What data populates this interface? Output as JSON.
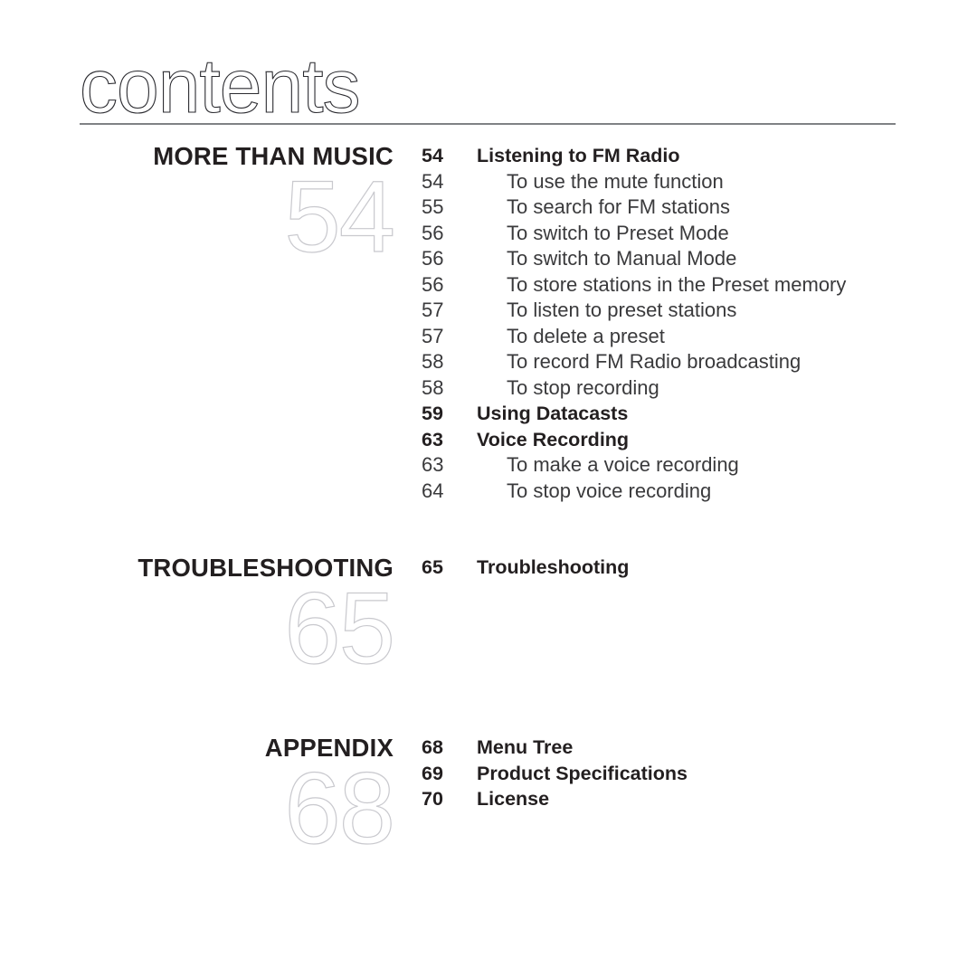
{
  "page": {
    "title": "contents"
  },
  "sections": [
    {
      "name": "more-than-music",
      "header": "MORE THAN MUSIC",
      "big_number": "54",
      "entries": [
        {
          "page": "54",
          "label": "Listening to FM Radio",
          "level": "major"
        },
        {
          "page": "54",
          "label": "To use the mute function",
          "level": "minor"
        },
        {
          "page": "55",
          "label": "To search for FM stations",
          "level": "minor"
        },
        {
          "page": "56",
          "label": "To switch to Preset Mode",
          "level": "minor"
        },
        {
          "page": "56",
          "label": "To switch to Manual Mode",
          "level": "minor"
        },
        {
          "page": "56",
          "label": "To store stations in the Preset memory",
          "level": "minor"
        },
        {
          "page": "57",
          "label": "To listen to preset stations",
          "level": "minor"
        },
        {
          "page": "57",
          "label": "To delete a preset",
          "level": "minor"
        },
        {
          "page": "58",
          "label": "To record FM Radio broadcasting",
          "level": "minor"
        },
        {
          "page": "58",
          "label": "To stop recording",
          "level": "minor"
        },
        {
          "page": "59",
          "label": "Using Datacasts",
          "level": "major"
        },
        {
          "page": "63",
          "label": "Voice Recording",
          "level": "major"
        },
        {
          "page": "63",
          "label": "To make a voice recording",
          "level": "minor"
        },
        {
          "page": "64",
          "label": "To stop voice recording",
          "level": "minor"
        }
      ]
    },
    {
      "name": "troubleshooting",
      "header": "TROUBLESHOOTING",
      "big_number": "65",
      "entries": [
        {
          "page": "65",
          "label": "Troubleshooting",
          "level": "major"
        }
      ]
    },
    {
      "name": "appendix",
      "header": "APPENDIX",
      "big_number": "68",
      "entries": [
        {
          "page": "68",
          "label": "Menu Tree",
          "level": "major"
        },
        {
          "page": "69",
          "label": "Product Specifications",
          "level": "major"
        },
        {
          "page": "70",
          "label": "License",
          "level": "major"
        }
      ]
    }
  ],
  "colors": {
    "text": "#231f20",
    "subtext": "#3a3a3c",
    "rule": "#808285",
    "outline_number": "#c9c9ce",
    "background": "#ffffff"
  },
  "layout": {
    "section_tops": [
      158,
      613,
      812
    ]
  }
}
